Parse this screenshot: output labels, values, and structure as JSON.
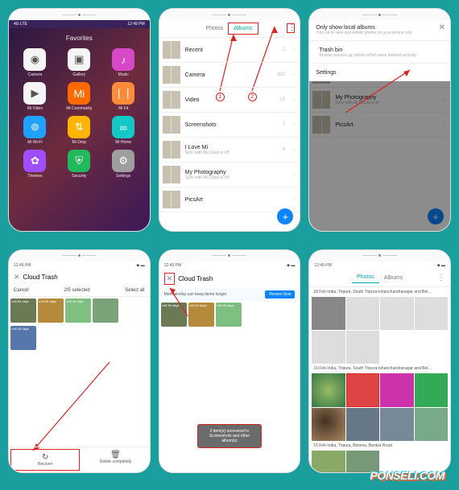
{
  "status": {
    "time": "12:49 PM",
    "carrier": "4G LTE",
    "battery": "85%"
  },
  "home": {
    "title": "Favorites",
    "apps": [
      {
        "label": "Camera",
        "color": "#f5f5f5",
        "glyph": "◉"
      },
      {
        "label": "Gallery",
        "color": "#f5f5f5",
        "glyph": "▣"
      },
      {
        "label": "Music",
        "color": "#d648c8",
        "glyph": "♪"
      },
      {
        "label": "Mi Video",
        "color": "#f5f5f5",
        "glyph": "▶"
      },
      {
        "label": "Mi Community",
        "color": "#ff6a00",
        "glyph": "Mi"
      },
      {
        "label": "Mi Fit",
        "color": "#ff8a3a",
        "glyph": "❘❘"
      },
      {
        "label": "Mi Wi-Fi",
        "color": "#1fa2ff",
        "glyph": "⊚"
      },
      {
        "label": "Mi Drop",
        "color": "#ffb400",
        "glyph": "⇅"
      },
      {
        "label": "Mi Home",
        "color": "#14c8c8",
        "glyph": "∞"
      },
      {
        "label": "Themes",
        "color": "#a04cff",
        "glyph": "✿"
      },
      {
        "label": "Security",
        "color": "#22b85c",
        "glyph": "⛨"
      },
      {
        "label": "Settings",
        "color": "#9e9e9e",
        "glyph": "⚙"
      }
    ]
  },
  "tabs": {
    "photos": "Photos",
    "albums": "Albums"
  },
  "albums": [
    {
      "title": "Recent",
      "sub": "",
      "count": "2"
    },
    {
      "title": "Camera",
      "sub": "",
      "count": "332"
    },
    {
      "title": "Video",
      "sub": "",
      "count": "13"
    },
    {
      "title": "Screenshots",
      "sub": "",
      "count": "7"
    },
    {
      "title": "I Love Mi",
      "sub": "Sync with Mi Cloud is off",
      "count": "3"
    },
    {
      "title": "My Photography",
      "sub": "Sync with Mi Cloud is off",
      "count": ""
    },
    {
      "title": "PicsArt",
      "sub": "",
      "count": ""
    }
  ],
  "sheet": {
    "opt1_title": "Only show local albums",
    "opt1_sub": "Turn on to view and delete photos on your device only",
    "trash_title": "Trash bin",
    "trash_sub": "Browse backed up photos which were deleted recently",
    "settings": "Settings"
  },
  "cloud_trash": {
    "title": "Cloud Trash",
    "cancel": "Cancel",
    "selected": "2/5 selected",
    "select_all": "Select all",
    "thumbs": [
      {
        "label": "Left 59 days",
        "bg": "#6b7a55"
      },
      {
        "label": "Left 60 days",
        "bg": "#b58a3a"
      },
      {
        "label": "Left 40 days",
        "bg": "#7fbf7f"
      },
      {
        "label": "",
        "bg": "#7aa37a"
      },
      {
        "label": "Left 45 days",
        "bg": "#5577aa"
      }
    ],
    "recover": "Recover",
    "delete": "Delete completely"
  },
  "banner": {
    "text": "Membership can keep items longer",
    "button": "Renew Now"
  },
  "toast": "2 item(s) recovered to Screenshots and other album(s)",
  "dates": [
    "18 Feb  India, Tripura, South Tripura-Ishanchandranagar and Bel…",
    "16 Feb  India, Tripura, South Tripura-Ishanchandranagar and Bel…",
    "15 Feb  India, Tripura, Belonia, Bankar Road"
  ],
  "watermark": "PONSELI.COM"
}
